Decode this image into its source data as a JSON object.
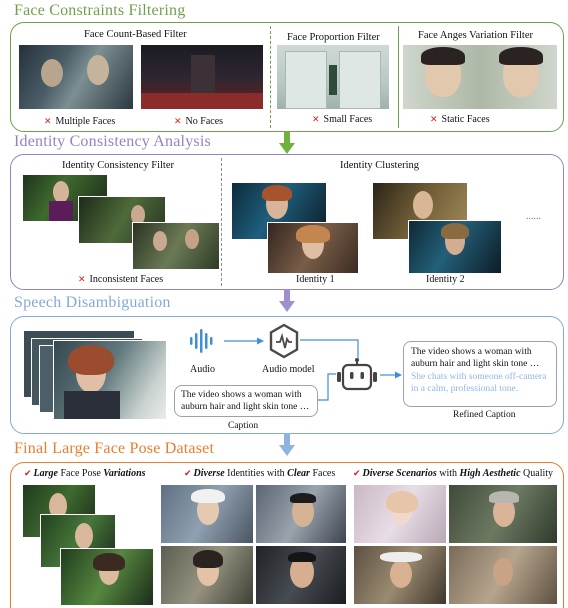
{
  "colors": {
    "green": "#6fa14a",
    "purple": "#8f85c4",
    "blue": "#84a9d6",
    "orange": "#e77e2d",
    "reject": "#e11d1d",
    "arrow_green": "#6fb23b",
    "arrow_purple": "#a08fd0",
    "arrow_blue": "#8db3e0",
    "wave_blue": "#3f8fd6",
    "refined_blue": "#8fb7e6"
  },
  "stage1": {
    "title": "Face Constraints Filtering",
    "count_filter": {
      "header": "Face Count-Based Filter",
      "multiple": "Multiple Faces",
      "none": "No Faces"
    },
    "proportion_filter": {
      "header": "Face Proportion Filter",
      "small": "Small Faces"
    },
    "angles_filter": {
      "header": "Face Anges Variation Filter",
      "static": "Static Faces"
    }
  },
  "stage2": {
    "title": "Identity Consistency Analysis",
    "consistency_filter": {
      "header": "Identity Consistency Filter",
      "inconsistent": "Inconsistent Faces"
    },
    "clustering": {
      "header": "Identity Clustering",
      "identity1": "Identity 1",
      "identity2": "Identity 2",
      "ellipsis": "......"
    }
  },
  "stage3": {
    "title": "Speech Disambiguation",
    "audio_label": "Audio",
    "model_label": "Audio model",
    "caption_text": "The video shows a woman with auburn hair and light skin tone …",
    "caption_label": "Caption",
    "refined_text_black": "The video shows a woman with auburn hair and light skin tone …",
    "refined_text_blue": "She chats with someone off-camera in a calm, professional tone.",
    "refined_label": "Refined Caption"
  },
  "stage4": {
    "title": "Final Large Face Pose Dataset",
    "feature1": {
      "italic_a": "Large",
      "plain_a": " Face Pose ",
      "italic_b": "Variations"
    },
    "feature2": {
      "italic_a": "Diverse",
      "plain_a": " Identities with ",
      "italic_b": "Clear",
      "plain_b": " Faces"
    },
    "feature3": {
      "italic_a": "Diverse Scenarios",
      "plain_a": " with ",
      "italic_b": "High Aesthetic",
      "plain_b": " Quality"
    }
  },
  "icons": {
    "reject": "x-mark-icon",
    "check": "check-mark-icon",
    "audio": "sound-wave-icon",
    "model": "audio-model-hexagon-icon",
    "robot": "robot-icon",
    "arrow": "down-arrow-icon"
  }
}
